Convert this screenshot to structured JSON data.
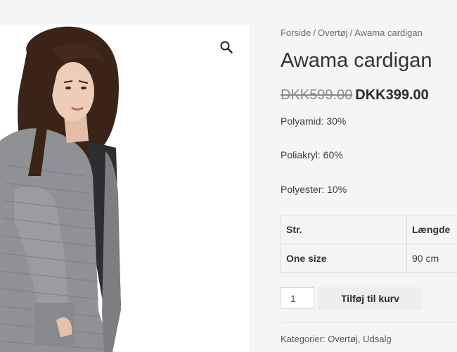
{
  "gallery": {
    "image_alt": "Awama cardigan",
    "zoom_icon": "magnifier-icon"
  },
  "breadcrumb": {
    "items": [
      "Forside",
      "Overtøj",
      "Awama cardigan"
    ],
    "separator": "/"
  },
  "product": {
    "title": "Awama cardigan",
    "price_regular": "DKK599.00",
    "price_sale": "DKK399.00",
    "description": [
      "Polyamid: 30%",
      "Poliakryl: 60%",
      "Polyester: 10%"
    ]
  },
  "attributes": {
    "headers": [
      "Str.",
      "Længde"
    ],
    "rows": [
      [
        "One size",
        "90 cm"
      ]
    ]
  },
  "cart": {
    "quantity": "1",
    "button_label": "Tilføj til kurv"
  },
  "meta": {
    "label": "Kategorier:",
    "categories": [
      "Overtøj",
      "Udsalg"
    ],
    "separator": ","
  }
}
